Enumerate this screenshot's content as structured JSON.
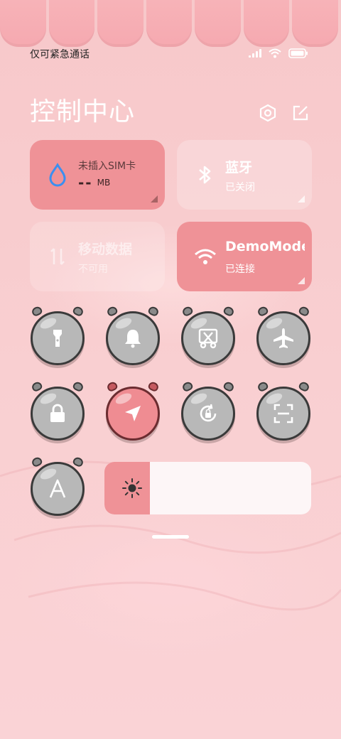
{
  "status_bar": {
    "carrier_text": "仅可紧急通话",
    "icons": [
      "signal-icon",
      "wifi-icon",
      "battery-icon"
    ]
  },
  "header": {
    "title": "控制中心",
    "icons": [
      "settings-icon",
      "edit-icon"
    ]
  },
  "tiles": {
    "sim": {
      "title": "未插入SIM卡",
      "value": "--",
      "unit": "MB",
      "icon": "water-drop-icon"
    },
    "bluetooth": {
      "title": "蓝牙",
      "status": "已关闭",
      "icon": "bluetooth-icon"
    },
    "mobile_data": {
      "title": "移动数据",
      "status": "不可用",
      "icon": "data-arrows-icon"
    },
    "wifi": {
      "title": "DemoMode",
      "status": "已连接",
      "icon": "wifi-icon"
    }
  },
  "toggles": [
    {
      "name": "flashlight",
      "icon": "flashlight-icon",
      "active": false
    },
    {
      "name": "mute",
      "icon": "bell-icon",
      "active": false
    },
    {
      "name": "screenshot",
      "icon": "scissors-icon",
      "active": false
    },
    {
      "name": "airplane-mode",
      "icon": "airplane-icon",
      "active": false
    },
    {
      "name": "lock-screen",
      "icon": "lock-icon",
      "active": false
    },
    {
      "name": "location",
      "icon": "location-arrow-icon",
      "active": true
    },
    {
      "name": "auto-rotate",
      "icon": "rotate-lock-icon",
      "active": false
    },
    {
      "name": "scanner",
      "icon": "scan-icon",
      "active": false
    },
    {
      "name": "auto-brightness",
      "icon": "letter-a-icon",
      "active": false
    }
  ],
  "brightness": {
    "icon": "brightness-icon",
    "level": 0.22
  },
  "colors": {
    "accent": "#ef9297",
    "inactive": "#b8b8b8",
    "background": "#f7c8ca"
  }
}
